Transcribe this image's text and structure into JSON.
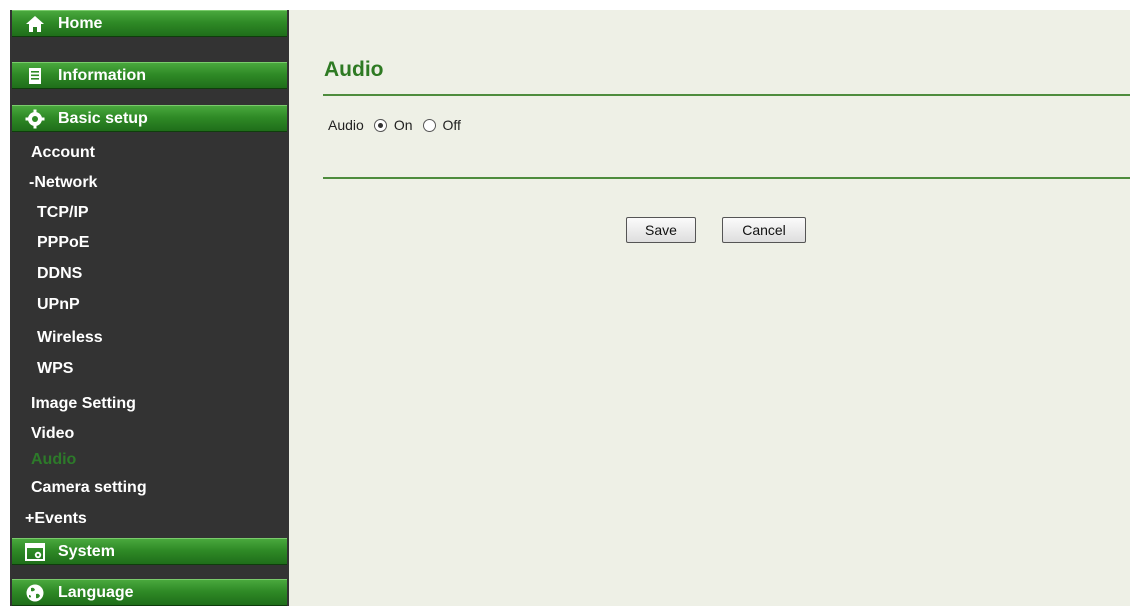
{
  "sidebar": {
    "home": "Home",
    "information": "Information",
    "basic_setup": "Basic setup",
    "account": "Account",
    "network": "-Network",
    "tcpip": "TCP/IP",
    "pppoe": "PPPoE",
    "ddns": "DDNS",
    "upnp": "UPnP",
    "wireless": "Wireless",
    "wps": "WPS",
    "image_setting": "Image Setting",
    "video": "Video",
    "audio": "Audio",
    "camera_setting": "Camera setting",
    "events": "+Events",
    "system": "System",
    "language": "Language"
  },
  "page": {
    "title": "Audio",
    "audio_label": "Audio",
    "on_label": "On",
    "off_label": "Off",
    "selected": "On",
    "save_label": "Save",
    "cancel_label": "Cancel"
  },
  "colors": {
    "accent": "#2e7a23",
    "sidebar_bg": "#333333",
    "content_bg": "#eef0e6"
  },
  "icons": {
    "home": "home-icon",
    "information": "document-icon",
    "basic_setup": "gear-icon",
    "system": "window-gear-icon",
    "language": "globe-icon"
  }
}
